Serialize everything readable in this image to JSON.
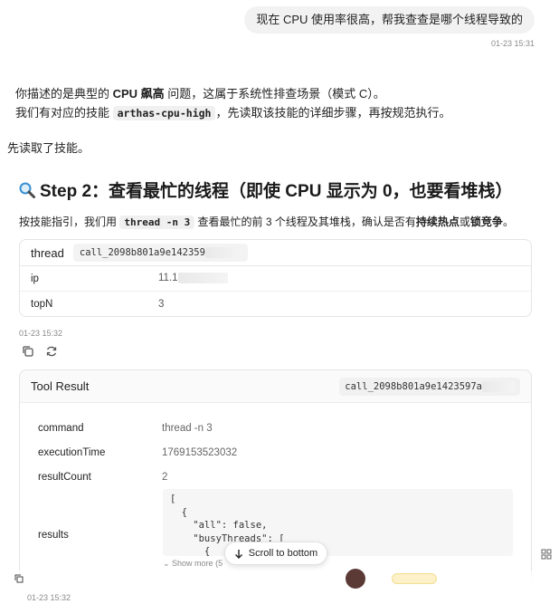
{
  "user_message": {
    "text": "现在 CPU 使用率很高，帮我查查是哪个线程导致的",
    "time": "01-23 15:31"
  },
  "assistant": {
    "line1_a": "你描述的是典型的 ",
    "line1_b": "CPU 飙高",
    "line1_c": " 问题，这属于系统性排查场景（模式 C）。",
    "line2_a": "我们有对应的技能 ",
    "line2_code": "arthas-cpu-high",
    "line2_b": "，先读取该技能的详细步骤，再按规范执行。",
    "line3": "先读取了技能。",
    "step_icon": "magnifier-emoji",
    "step_title": "Step 2：查看最忙的线程（即使 CPU 显示为 0，也要看堆栈）",
    "step_desc_a": "按技能指引，我们用 ",
    "step_desc_code": "thread -n 3",
    "step_desc_b": " 查看最忙的前 3 个线程及其堆栈，确认是否有",
    "step_desc_bold1": "持续热点",
    "step_desc_c": "或",
    "step_desc_bold2": "锁竞争",
    "step_desc_d": "。"
  },
  "tool_call": {
    "name": "thread",
    "call_id": "call_2098b801a9e142359",
    "params": [
      {
        "key": "ip",
        "value": "11.1"
      },
      {
        "key": "topN",
        "value": "3"
      }
    ],
    "time": "01-23 15:32"
  },
  "actions": {
    "copy_icon": "copy-icon",
    "refresh_icon": "refresh-icon"
  },
  "tool_result": {
    "title": "Tool Result",
    "call_id": "call_2098b801a9e1423597a",
    "rows": [
      {
        "key": "command",
        "value": "thread -n 3"
      },
      {
        "key": "executionTime",
        "value": "1769153523032"
      },
      {
        "key": "resultCount",
        "value": "2"
      }
    ],
    "results_label": "results",
    "results_code": "[\n  {\n    \"all\": false,\n    \"busyThreads\": [\n      {",
    "show_more": "Show more (5"
  },
  "scroll_button": {
    "label": "Scroll to bottom",
    "icon": "arrow-down-icon"
  },
  "bottom": {
    "time": "01-23 15:32"
  }
}
